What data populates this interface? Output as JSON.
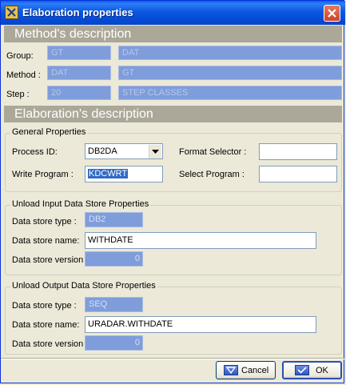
{
  "window": {
    "title": "Elaboration properties"
  },
  "method_section": {
    "header": "Method's description",
    "group_label": "Group:",
    "group_code": "GT",
    "group_name": "DAT",
    "method_label": "Method :",
    "method_code": "DAT",
    "method_name": "GT",
    "step_label": "Step :",
    "step_code": "20",
    "step_name": "STEP CLASSES"
  },
  "elaboration_section": {
    "header": "Elaboration's description"
  },
  "general_properties": {
    "title": "General Properties",
    "process_id_label": "Process ID:",
    "process_id_value": "DB2DA",
    "format_selector_label": "Format Selector :",
    "format_selector_value": "",
    "write_program_label": "Write Program :",
    "write_program_value": "KDCWRT",
    "select_program_label": "Select Program :",
    "select_program_value": ""
  },
  "unload_input": {
    "title": "Unload Input Data Store Properties",
    "type_label": "Data store type :",
    "type_value": "DB2",
    "name_label": "Data store name:",
    "name_value": "WITHDATE",
    "version_label": "Data store version :",
    "version_value": "0"
  },
  "unload_output": {
    "title": "Unload Output Data Store Properties",
    "type_label": "Data store type :",
    "type_value": "SEQ",
    "name_label": "Data store name:",
    "name_value": "URADAR.WITHDATE",
    "version_label": "Data store version :",
    "version_value": "0"
  },
  "buttons": {
    "cancel": "Cancel",
    "ok": "OK"
  }
}
